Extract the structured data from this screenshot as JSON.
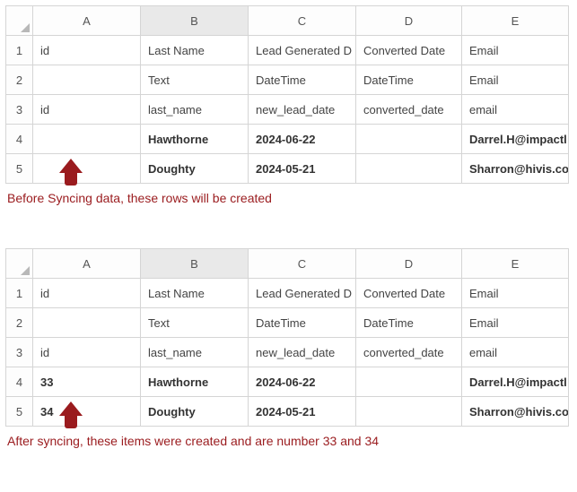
{
  "columns": [
    "A",
    "B",
    "C",
    "D",
    "E"
  ],
  "row_numbers": [
    "1",
    "2",
    "3",
    "4",
    "5"
  ],
  "header_row": {
    "A": "id",
    "B": "Last Name",
    "C": "Lead Generated D",
    "D": "Converted Date",
    "E": "Email"
  },
  "type_row": {
    "A": "",
    "B": "Text",
    "C": "DateTime",
    "D": "DateTime",
    "E": "Email"
  },
  "field_row": {
    "A": "id",
    "B": "last_name",
    "C": "new_lead_date",
    "D": "converted_date",
    "E": "email"
  },
  "before": {
    "rows": [
      {
        "A": "",
        "B": "Hawthorne",
        "C": "2024-06-22",
        "D": "",
        "E": "Darrel.H@impactl"
      },
      {
        "A": "",
        "B": "Doughty",
        "C": "2024-05-21",
        "D": "",
        "E": "Sharron@hivis.co"
      }
    ],
    "caption": "Before Syncing data, these rows will be created"
  },
  "after": {
    "rows": [
      {
        "A": "33",
        "B": "Hawthorne",
        "C": "2024-06-22",
        "D": "",
        "E": "Darrel.H@impactl"
      },
      {
        "A": "34",
        "B": "Doughty",
        "C": "2024-05-21",
        "D": "",
        "E": "Sharron@hivis.co"
      }
    ],
    "caption": "After syncing, these items were created and are number 33 and 34"
  }
}
